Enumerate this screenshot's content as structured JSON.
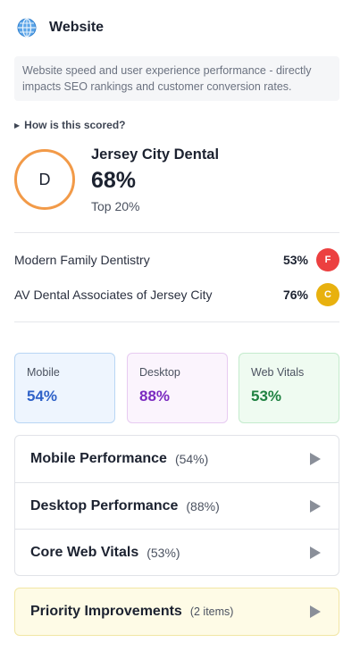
{
  "header": {
    "title": "Website",
    "icon": "globe-icon"
  },
  "description": "Website speed and user experience performance - directly impacts SEO rankings and customer conversion rates.",
  "scoring_toggle": {
    "label": "How is this scored?"
  },
  "business": {
    "grade": "D",
    "name": "Jersey City Dental",
    "score": "68%",
    "rank": "Top 20%",
    "ring_color": "#f29a48"
  },
  "competitors": [
    {
      "name": "Modern Family Dentistry",
      "score": "53%",
      "grade": "F",
      "badge_color": "#ec4040"
    },
    {
      "name": "AV Dental Associates of Jersey City",
      "score": "76%",
      "grade": "C",
      "badge_color": "#e8b10f"
    }
  ],
  "metrics": [
    {
      "label": "Mobile",
      "value": "54%"
    },
    {
      "label": "Desktop",
      "value": "88%"
    },
    {
      "label": "Web Vitals",
      "value": "53%"
    }
  ],
  "sections": [
    {
      "title": "Mobile Performance",
      "detail": "(54%)"
    },
    {
      "title": "Desktop Performance",
      "detail": "(88%)"
    },
    {
      "title": "Core Web Vitals",
      "detail": "(53%)"
    }
  ],
  "priority": {
    "title": "Priority Improvements",
    "detail": "(2 items)"
  }
}
